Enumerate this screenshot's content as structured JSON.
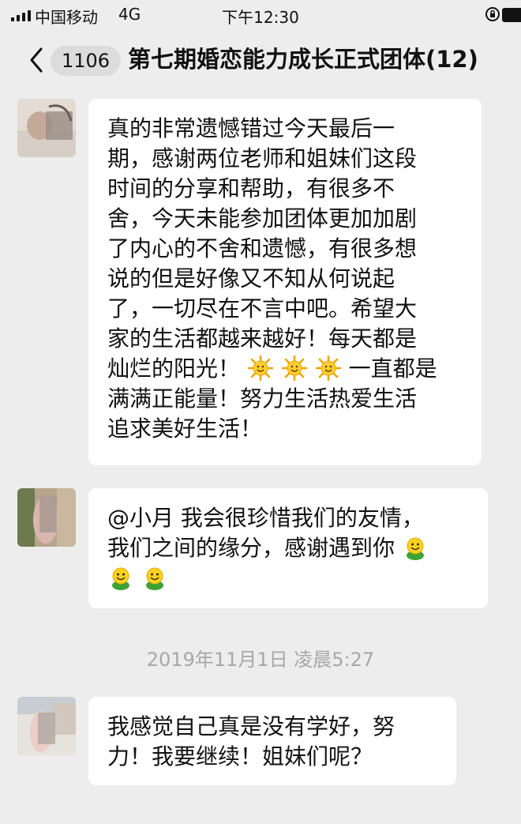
{
  "status_bar": {
    "carrier": "中国移动",
    "network": "4G",
    "time": "下午12:30"
  },
  "nav": {
    "unread_count": "1106",
    "title": "第七期婚恋能力成长正式团体(12)"
  },
  "messages": [
    {
      "lines": [
        "真的非常遗憾错过今天最后一",
        "期，感谢两位老师和姐妹们这段",
        "时间的分享和帮助，有很多不",
        "舍，今天未能参加团体更加加剧",
        "了内心的不舍和遗憾，有很多想",
        "说的但是好像又不知从何说起",
        "了，一切尽在不言中吧。希望大",
        "家的生活都越来越好！每天都是"
      ],
      "line9_start": "灿烂的阳光！",
      "line9_end": "一直都是",
      "line10": "满满正能量！努力生活热爱生活",
      "line11": "追求美好生活！"
    },
    {
      "line1": "@小月 我会很珍惜我们的友情，",
      "line2": "我们之间的缘分，感谢遇到你"
    },
    {
      "line1": "我感觉自己真是没有学好，努",
      "line2": "力！我要继续！姐妹们呢？"
    }
  ],
  "timestamp": "2019年11月1日 凌晨5:27",
  "icons": {
    "sun": "sun-emoji-icon",
    "smile": "smile-emoji-icon"
  }
}
